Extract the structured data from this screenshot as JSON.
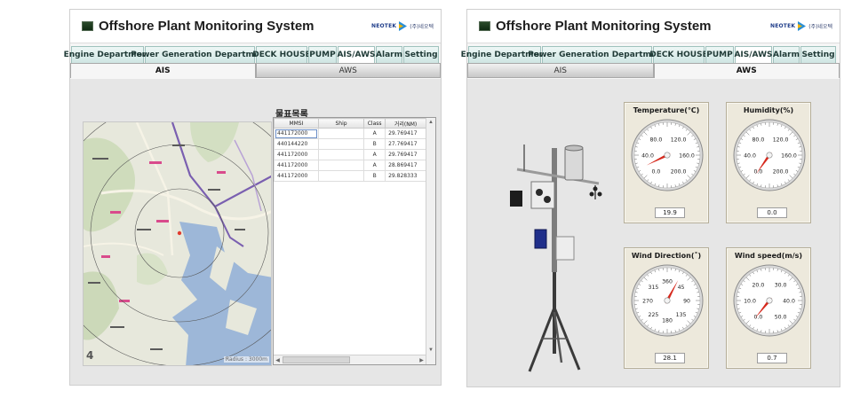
{
  "panels": [
    {
      "title": "Offshore Plant Monitoring System",
      "logo": {
        "brand": "NEOTEK",
        "corp": "(주)네오텍"
      },
      "tabs": [
        "Engine Department",
        "Power Generation Department",
        "DECK HOUSE",
        "PUMP",
        "AIS/AWS",
        "Alarm",
        "Setting"
      ],
      "active_tab": "AIS/AWS",
      "subtabs": [
        "AIS",
        "AWS"
      ],
      "active_subtab": "AIS"
    },
    {
      "title": "Offshore Plant Monitoring System",
      "logo": {
        "brand": "NEOTEK",
        "corp": "(주)네오텍"
      },
      "tabs": [
        "Engine Department",
        "Power Generation Department",
        "DECK HOUSE",
        "PUMP",
        "AIS/AWS",
        "Alarm",
        "Setting"
      ],
      "active_tab": "AIS/AWS",
      "subtabs": [
        "AIS",
        "AWS"
      ],
      "active_subtab": "AWS"
    }
  ],
  "ais": {
    "map_corner_label": "4",
    "map_radius_label": "Radius : 3000m",
    "target_list": {
      "title": "물표목록",
      "columns": [
        "MMSI",
        "Ship",
        "Class",
        "거리(NM)"
      ],
      "rows": [
        [
          "441172000",
          "",
          "A",
          "29.769417"
        ],
        [
          "440144220",
          "",
          "B",
          "27.769417"
        ],
        [
          "441172000",
          "",
          "A",
          "29.769417"
        ],
        [
          "441172000",
          "",
          "A",
          "28.869417"
        ],
        [
          "441172000",
          "",
          "B",
          "29.828333"
        ]
      ]
    }
  },
  "aws": {
    "gauges": [
      {
        "title": "Temperature(℃)",
        "ticks": [
          "80.0",
          "120.0",
          "40.0",
          "160.0",
          "0.0",
          "200.0"
        ],
        "min": 0,
        "max": 200,
        "value": 19.9,
        "display": "19.9",
        "needle_color": "#d62a1e"
      },
      {
        "title": "Humidity(%)",
        "ticks": [
          "80.0",
          "120.0",
          "40.0",
          "160.0",
          "0.0",
          "200.0"
        ],
        "min": 0,
        "max": 200,
        "value": 0.0,
        "display": "0.0",
        "needle_color": "#d62a1e"
      },
      {
        "title": "Wind Direction(˚)",
        "ticks": [
          "360",
          "315",
          "45",
          "270",
          "90",
          "225",
          "135",
          "180"
        ],
        "min": 0,
        "max": 360,
        "value": 28.1,
        "display": "28.1",
        "needle_color": "#d62a1e"
      },
      {
        "title": "Wind speed(m/s)",
        "ticks": [
          "20.0",
          "30.0",
          "10.0",
          "40.0",
          "0.0",
          "50.0"
        ],
        "min": 0,
        "max": 50,
        "value": 0.7,
        "display": "0.7",
        "needle_color": "#d62a1e"
      }
    ]
  }
}
